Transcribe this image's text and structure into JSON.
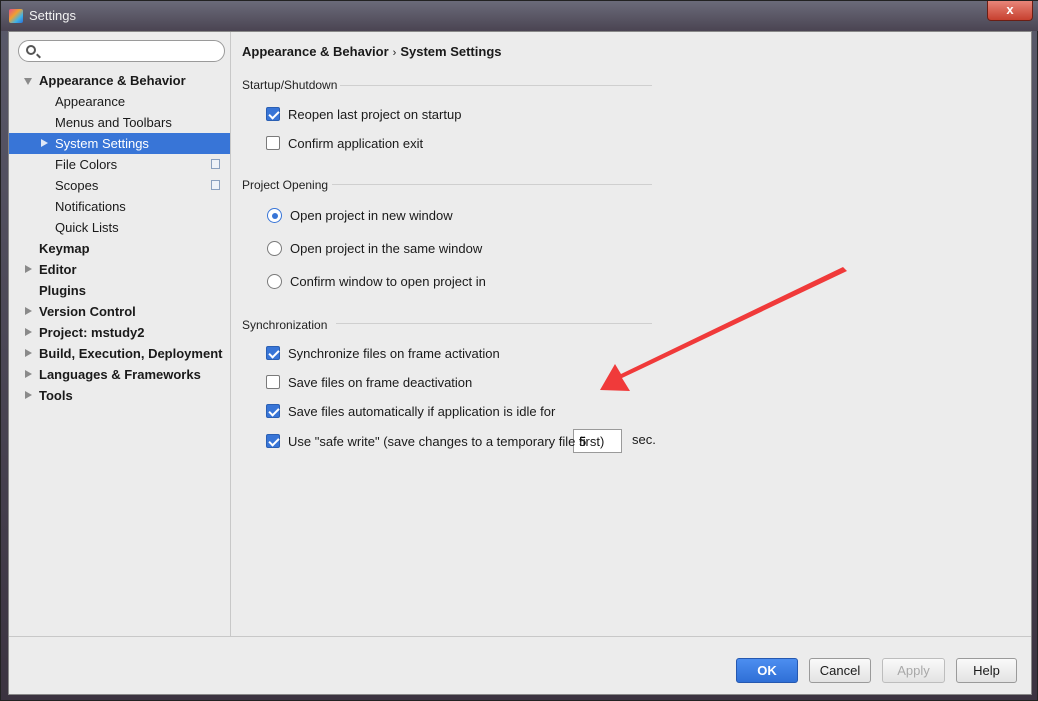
{
  "window": {
    "title": "Settings",
    "close_label": "x"
  },
  "search": {
    "placeholder": "",
    "value": ""
  },
  "tree": [
    {
      "label": "Appearance & Behavior",
      "level": 0,
      "expanded": true
    },
    {
      "label": "Appearance",
      "level": 1
    },
    {
      "label": "Menus and Toolbars",
      "level": 1
    },
    {
      "label": "System Settings",
      "level": 1,
      "selected": true,
      "has_children": true
    },
    {
      "label": "File Colors",
      "level": 1,
      "project_icon": true
    },
    {
      "label": "Scopes",
      "level": 1,
      "project_icon": true
    },
    {
      "label": "Notifications",
      "level": 1
    },
    {
      "label": "Quick Lists",
      "level": 1
    },
    {
      "label": "Keymap",
      "level": 0
    },
    {
      "label": "Editor",
      "level": 0,
      "has_children": true
    },
    {
      "label": "Plugins",
      "level": 0
    },
    {
      "label": "Version Control",
      "level": 0,
      "has_children": true
    },
    {
      "label": "Project: mstudy2",
      "level": 0,
      "has_children": true
    },
    {
      "label": "Build, Execution, Deployment",
      "level": 0,
      "has_children": true
    },
    {
      "label": "Languages & Frameworks",
      "level": 0,
      "has_children": true
    },
    {
      "label": "Tools",
      "level": 0,
      "has_children": true
    }
  ],
  "breadcrumb": {
    "parent": "Appearance & Behavior",
    "separator": "›",
    "current": "System Settings"
  },
  "startup": {
    "title": "Startup/Shutdown",
    "reopen_last": {
      "label": "Reopen last project on startup",
      "checked": true
    },
    "confirm_exit": {
      "label": "Confirm application exit",
      "checked": false
    }
  },
  "project_opening": {
    "title": "Project Opening",
    "new_window": {
      "label": "Open project in new window",
      "selected": true
    },
    "same_window": {
      "label": "Open project in the same window",
      "selected": false
    },
    "confirm_window": {
      "label": "Confirm window to open project in",
      "selected": false
    }
  },
  "sync": {
    "title": "Synchronization",
    "sync_on_activation": {
      "label": "Synchronize files on frame activation",
      "checked": true
    },
    "save_on_deactivation": {
      "label": "Save files on frame deactivation",
      "checked": false
    },
    "save_idle": {
      "label": "Save files automatically if application is idle for",
      "checked": true,
      "value": "5",
      "unit": "sec."
    },
    "safe_write": {
      "label": "Use \"safe write\" (save changes to a temporary file first)",
      "checked": true
    }
  },
  "buttons": {
    "ok": "OK",
    "cancel": "Cancel",
    "apply": "Apply",
    "help": "Help"
  },
  "colors": {
    "accent": "#3875d7",
    "annotation_arrow": "#f03a3a"
  }
}
